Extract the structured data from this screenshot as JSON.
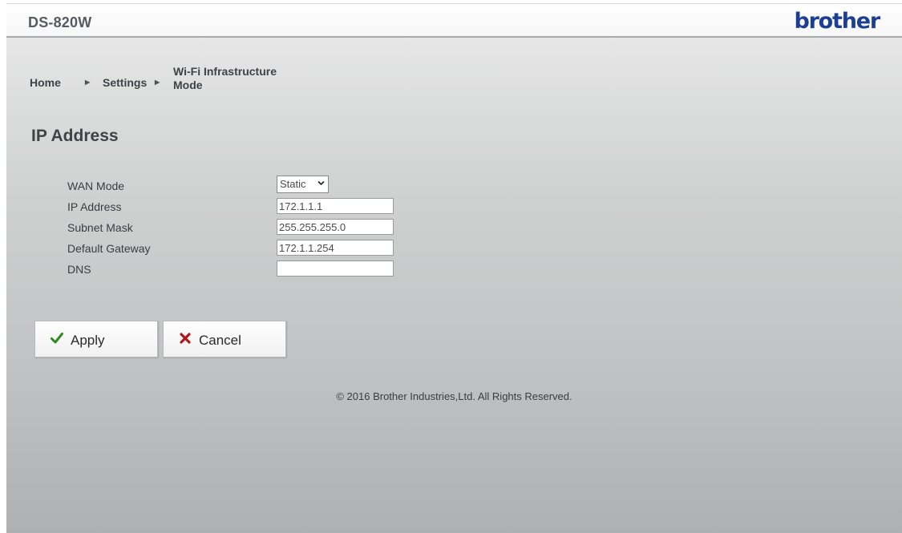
{
  "header": {
    "model": "DS-820W",
    "logo_text": "brother",
    "logo_color": "#1d3f93"
  },
  "breadcrumb": {
    "items": [
      "Home",
      "Settings",
      "Wi-Fi Infrastructure Mode"
    ],
    "separator_icon": "triangle-right-icon"
  },
  "page": {
    "title": "IP Address"
  },
  "form": {
    "wan_mode": {
      "label": "WAN Mode",
      "value": "Static",
      "icon": "chevron-down-icon"
    },
    "ip_address": {
      "label": "IP Address",
      "value": "172.1.1.1"
    },
    "subnet_mask": {
      "label": "Subnet Mask",
      "value": "255.255.255.0"
    },
    "default_gateway": {
      "label": "Default Gateway",
      "value": "172.1.1.254"
    },
    "dns": {
      "label": "DNS",
      "value": ""
    }
  },
  "buttons": {
    "apply": {
      "label": "Apply",
      "icon": "checkmark-icon",
      "icon_color": "#2f8a1f"
    },
    "cancel": {
      "label": "Cancel",
      "icon": "x-icon",
      "icon_color": "#b0171c"
    }
  },
  "footer": {
    "copyright": "© 2016 Brother Industries,Ltd. All Rights Reserved."
  }
}
